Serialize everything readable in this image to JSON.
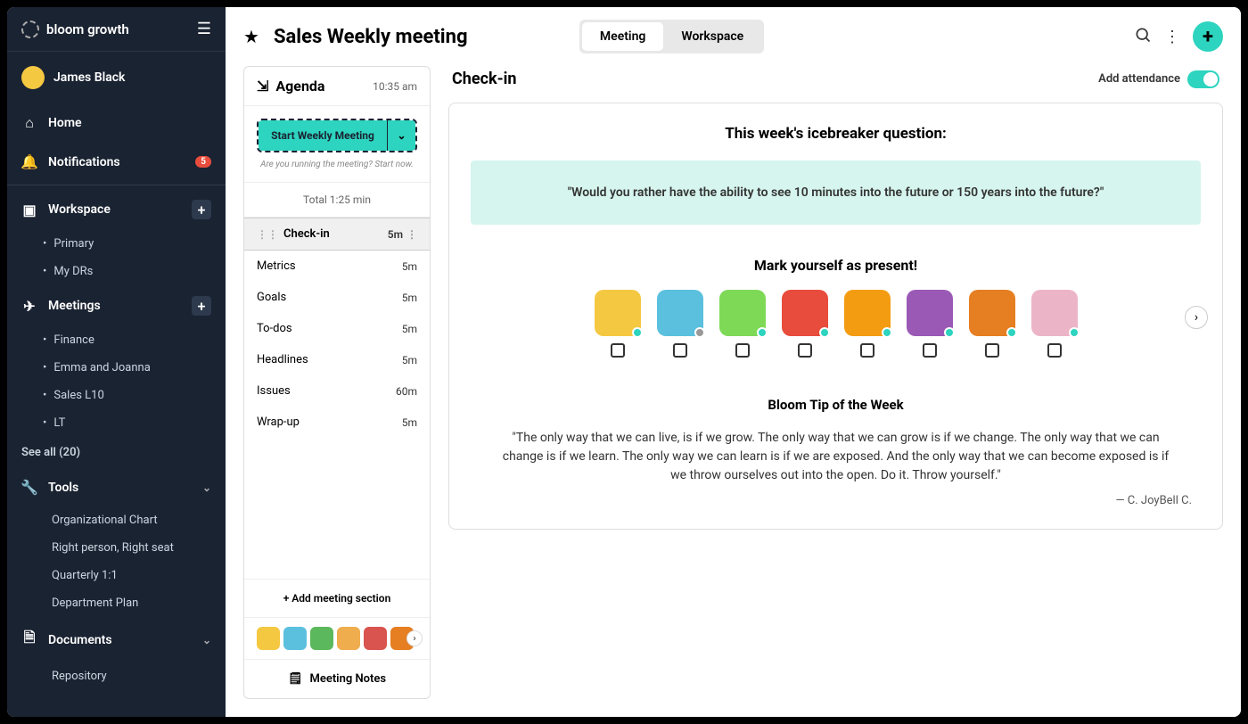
{
  "brand": "bloom growth",
  "user": {
    "name": "James Black"
  },
  "nav": {
    "home": "Home",
    "notifications": "Notifications",
    "notif_count": "5"
  },
  "workspace": {
    "label": "Workspace",
    "items": [
      "Primary",
      "My DRs"
    ]
  },
  "meetings": {
    "label": "Meetings",
    "items": [
      "Finance",
      "Emma and Joanna",
      "Sales L10",
      "LT"
    ],
    "see_all": "See all (20)"
  },
  "tools": {
    "label": "Tools",
    "items": [
      "Organizational Chart",
      "Right person, Right seat",
      "Quarterly 1:1",
      "Department Plan"
    ]
  },
  "documents": {
    "label": "Documents",
    "items": [
      "Repository"
    ]
  },
  "header": {
    "title": "Sales Weekly meeting",
    "tabs": {
      "meeting": "Meeting",
      "workspace": "Workspace"
    }
  },
  "agenda": {
    "title": "Agenda",
    "time": "10:35 am",
    "start_label": "Start Weekly Meeting",
    "helper": "Are you running the meeting? Start now.",
    "total": "Total 1:25 min",
    "items": [
      {
        "label": "Check-in",
        "dur": "5m",
        "active": true
      },
      {
        "label": "Metrics",
        "dur": "5m"
      },
      {
        "label": "Goals",
        "dur": "5m"
      },
      {
        "label": "To-dos",
        "dur": "5m"
      },
      {
        "label": "Headlines",
        "dur": "5m"
      },
      {
        "label": "Issues",
        "dur": "60m"
      },
      {
        "label": "Wrap-up",
        "dur": "5m"
      }
    ],
    "add_section": "+ Add meeting section",
    "notes": "Meeting Notes",
    "mini_colors": [
      "#f5c842",
      "#5bc0de",
      "#5cb85c",
      "#f0ad4e",
      "#d9534f",
      "#e67e22"
    ]
  },
  "checkin": {
    "title": "Check-in",
    "add_attendance": "Add attendance",
    "icebreaker_heading": "This week's icebreaker question:",
    "icebreaker_text": "\"Would you rather have the ability to see 10 minutes into the future or 150 years into the future?\"",
    "present_heading": "Mark yourself as present!",
    "people": [
      {
        "bg": "#f5c842",
        "status": "#2dd4bf"
      },
      {
        "bg": "#5bc0de",
        "status": "#999"
      },
      {
        "bg": "#7ed957",
        "status": "#2dd4bf"
      },
      {
        "bg": "#e74c3c",
        "status": "#2dd4bf"
      },
      {
        "bg": "#f39c12",
        "status": "#2dd4bf"
      },
      {
        "bg": "#9b59b6",
        "status": "#2dd4bf"
      },
      {
        "bg": "#e67e22",
        "status": "#2dd4bf"
      },
      {
        "bg": "#ecb4c7",
        "status": "#2dd4bf"
      }
    ],
    "tip_heading": "Bloom Tip of the Week",
    "tip_text": "\"The only way that we can live, is if we grow. The only way that we can grow is if we change. The only way that we can change is if we learn. The only way we can learn is if we are exposed. And the only way that we can become exposed is if we throw ourselves out into the open. Do it. Throw yourself.\"",
    "tip_author": "— C. JoyBell C."
  }
}
